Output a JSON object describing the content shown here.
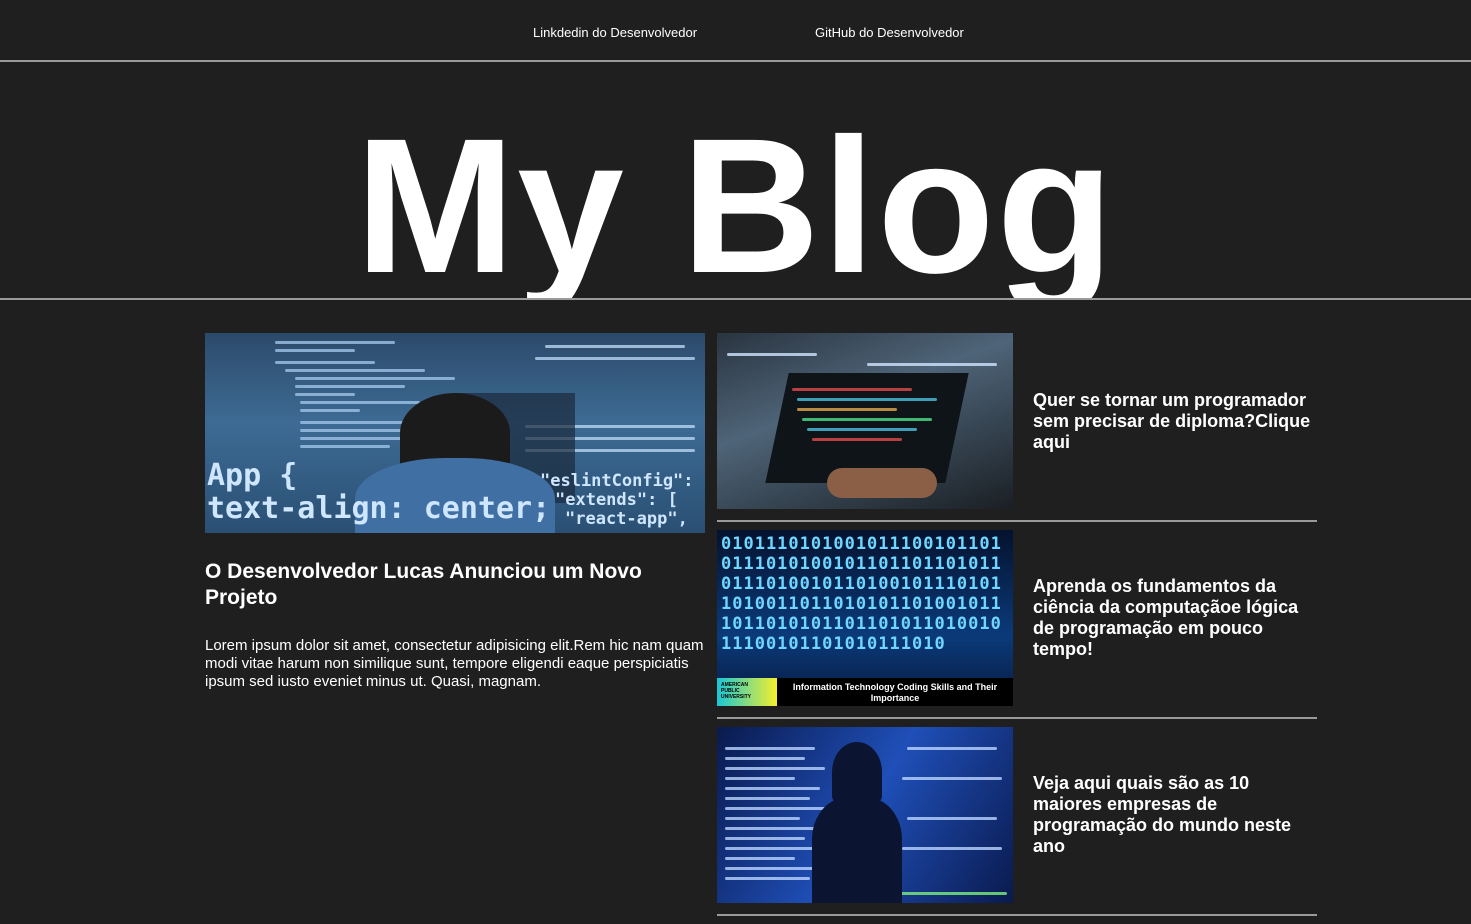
{
  "nav": {
    "links": [
      {
        "label": "Linkdedin do Desenvolvedor"
      },
      {
        "label": "GitHub do Desenvolvedor"
      }
    ]
  },
  "hero": {
    "title": "My Blog"
  },
  "featured": {
    "title": "O Desenvolvedor Lucas Anunciou um Novo Projeto",
    "body": "Lorem ipsum dolor sit amet, consectetur adipisicing elit.Rem hic nam quam modi vitae harum non similique sunt, tempore eligendi eaque perspiciatis ipsum sed iusto eveniet minus ut. Quasi, magnam.",
    "image_code": [
      "App {",
      "text-align: center;",
      "\"eslintConfig\": {",
      "\"extends\": [",
      "\"react-app\","
    ]
  },
  "side": {
    "items": [
      {
        "title": "Quer se tornar um programador sem precisar de diploma?Clique aqui"
      },
      {
        "title": "Aprenda os fundamentos da ciência da computaçãoe lógica de programação em pouco tempo!"
      },
      {
        "title": "Veja aqui quais são as 10 maiores empresas de programação do mundo neste ano"
      }
    ],
    "banner": {
      "brand": "AMERICAN PUBLIC UNIVERSITY",
      "caption": "Information Technology Coding Skills and Their Importance"
    }
  },
  "colors": {
    "background": "#1f1f1f",
    "divider": "#9a9a9a",
    "text": "#ffffff"
  }
}
